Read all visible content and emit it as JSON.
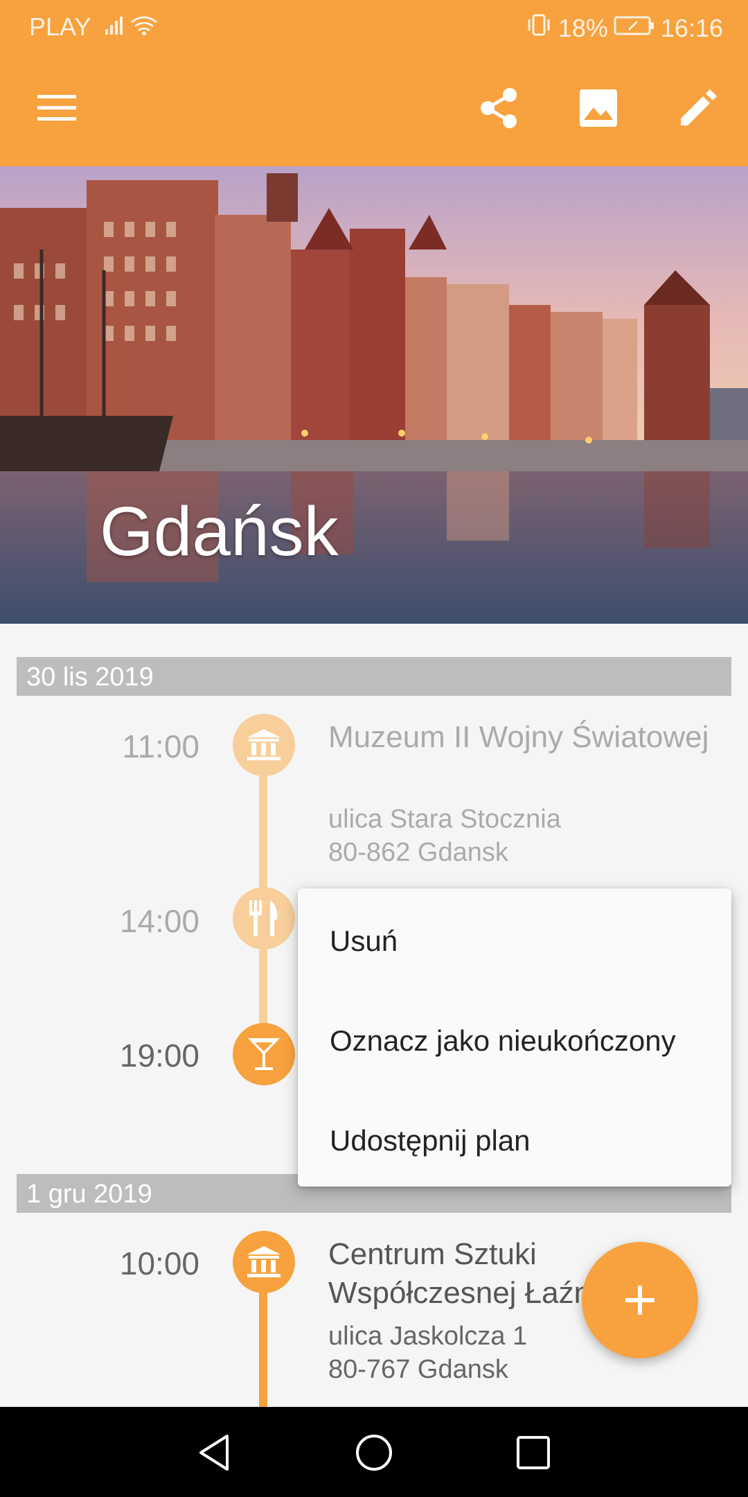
{
  "status_bar": {
    "carrier": "PLAY",
    "battery": "18%",
    "time": "16:16"
  },
  "toolbar": {
    "menu_icon": "hamburger-menu-icon",
    "share_icon": "share-icon",
    "image_icon": "image-icon",
    "edit_icon": "edit-pencil-icon"
  },
  "hero": {
    "title": "Gdańsk"
  },
  "days": [
    {
      "date": "30 lis 2019",
      "events": [
        {
          "time": "11:00",
          "icon": "museum-icon",
          "name": "Muzeum II Wojny Światowej",
          "address_line1": "ulica Stara Stocznia",
          "address_line2": "80-862 Gdansk"
        },
        {
          "time": "14:00",
          "icon": "restaurant-icon"
        },
        {
          "time": "19:00",
          "icon": "cocktail-icon"
        }
      ]
    },
    {
      "date": "1 gru 2019",
      "events": [
        {
          "time": "10:00",
          "icon": "museum-icon",
          "name": "Centrum Sztuki Współczesnej Łaźnia",
          "address_line1": "ulica Jaskolcza 1",
          "address_line2": "80-767 Gdansk"
        }
      ]
    }
  ],
  "popup_menu": {
    "items": [
      "Usuń",
      "Oznacz jako nieukończony",
      "Udostępnij plan"
    ]
  },
  "fab": {
    "icon": "add-icon"
  },
  "nav_bar": {
    "back_icon": "back-triangle-icon",
    "home_icon": "home-circle-icon",
    "recents_icon": "recents-square-icon"
  },
  "colors": {
    "accent": "#f7a23e",
    "accent_faded": "#f8cf9a",
    "date_bar": "#bdbdbd"
  }
}
